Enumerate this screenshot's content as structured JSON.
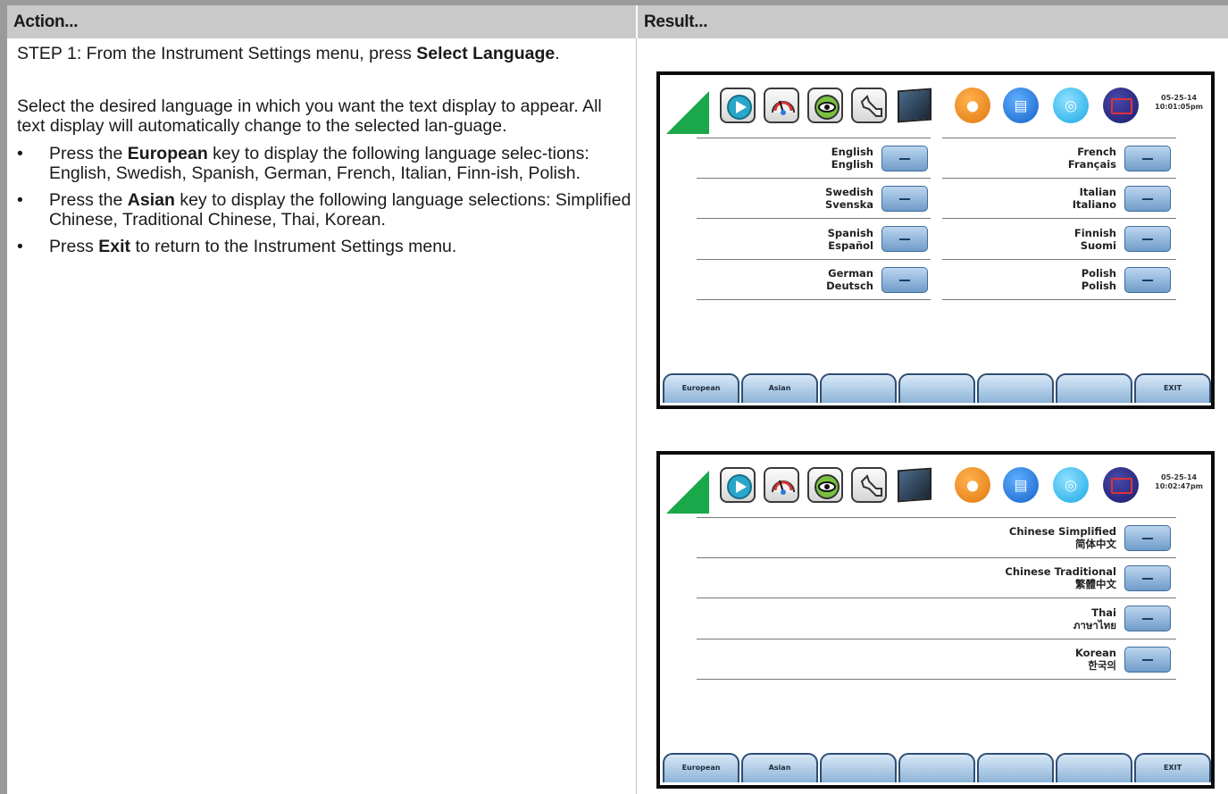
{
  "table": {
    "action_header": "Action...",
    "result_header": "Result..."
  },
  "action": {
    "step_prefix": "STEP 1: From the Instrument Settings menu, press ",
    "step_key": "Select Language",
    "step_suffix": ".",
    "intro": "Select the desired language in which you want the text display to appear. All text display will automatically change to the selected lan-guage.",
    "bullets": [
      {
        "pre": "Press the ",
        "key": "European",
        "post": " key to display the following language selec-tions: English, Swedish, Spanish, German, French, Italian, Finn-ish, Polish."
      },
      {
        "pre": "Press the ",
        "key": "Asian",
        "post": " key to display the following language selections: Simplified Chinese, Traditional Chinese, Thai, Korean."
      },
      {
        "pre": "Press ",
        "key": "Exit",
        "post": " to return to the Instrument Settings menu."
      }
    ]
  },
  "screens": [
    {
      "datetime": [
        "05-25-14",
        "10:01:05pm"
      ],
      "left_column": [
        {
          "name": "English",
          "native": "English"
        },
        {
          "name": "Swedish",
          "native": "Svenska"
        },
        {
          "name": "Spanish",
          "native": "Español"
        },
        {
          "name": "German",
          "native": "Deutsch"
        }
      ],
      "right_column": [
        {
          "name": "French",
          "native": "Français"
        },
        {
          "name": "Italian",
          "native": "Italiano"
        },
        {
          "name": "Finnish",
          "native": "Suomi"
        },
        {
          "name": "Polish",
          "native": "Polish"
        }
      ],
      "softkeys": [
        "European",
        "Asian",
        "",
        "",
        "",
        "",
        "EXIT"
      ]
    },
    {
      "datetime": [
        "05-25-14",
        "10:02:47pm"
      ],
      "left_column": [],
      "right_column": [
        {
          "name": "Chinese Simplified",
          "native": "简体中文"
        },
        {
          "name": "Chinese Traditional",
          "native": "繁體中文"
        },
        {
          "name": "Thai",
          "native": "ภาษาไทย"
        },
        {
          "name": "Korean",
          "native": "한국의"
        }
      ],
      "softkeys": [
        "European",
        "Asian",
        "",
        "",
        "",
        "",
        "EXIT"
      ]
    }
  ],
  "icons": [
    "signal-icon",
    "play-icon",
    "gauge-icon",
    "eye-icon",
    "wrench-icon",
    "monitor-icon",
    "camera-icon",
    "document-icon",
    "wifi-icon",
    "display-icon"
  ],
  "colors": {
    "header_bg": "#c9c9c9",
    "button_blue": "#6f9cc9",
    "signal_green": "#1ba84a"
  }
}
